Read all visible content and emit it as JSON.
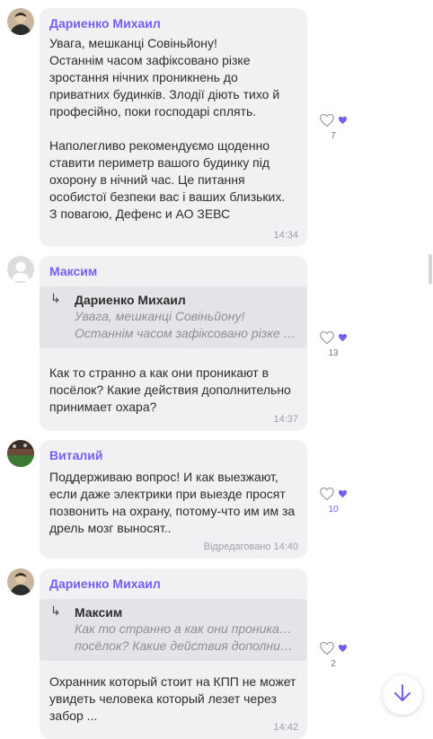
{
  "messages": [
    {
      "author": "Дариенко Михаил",
      "text": "Увага, мешканці Совіньйону!\nОстаннім часом зафіксовано різке зростання нічних проникнень до приватних будинків. Злодії діють тихо й професійно, поки господарі сплять.\n\nНаполегливо рекомендуємо щоденно ставити периметр вашого будинку під охорону в нічний час. Це питання особистої безпеки вас і ваших близьких.\nЗ повагою, Дефенс и АО ЗЕВС",
      "time": "14:34",
      "likes": "7"
    },
    {
      "author": "Максим",
      "reply_author": "Дариенко Михаил",
      "reply_line1": "Увага, мешканці Совіньйону!",
      "reply_line2": "Останнім часом зафіксовано різке зростання...",
      "text": "Как то странно а как они проникают в посёлок? Какие действия дополнительно принимает охара?",
      "time": "14:37",
      "likes": "13"
    },
    {
      "author": "Виталий",
      "text": "Поддерживаю вопрос! И как выезжают, если даже электрики при выезде просят позвонить на охрану, потому-что им им за дрель мозг выносят..",
      "time": "Відредаговано 14:40",
      "likes": "10"
    },
    {
      "author": "Дариенко Михаил",
      "reply_author": "Максим",
      "reply_line1": "Как то странно а как они проникают в",
      "reply_line2": "посёлок? Какие действия дополнительно принимает охара?",
      "text": "Охранник который стоит на КПП не может увидеть человека который лезет через забор ...",
      "time": "14:42",
      "likes": "2"
    }
  ],
  "colors": {
    "accent": "#7360f2",
    "bubble": "#f1f1f4",
    "reply_bg": "#e4e4e8"
  },
  "icons": {
    "scroll_down": "arrow-down-icon",
    "like": "heart-icon"
  }
}
